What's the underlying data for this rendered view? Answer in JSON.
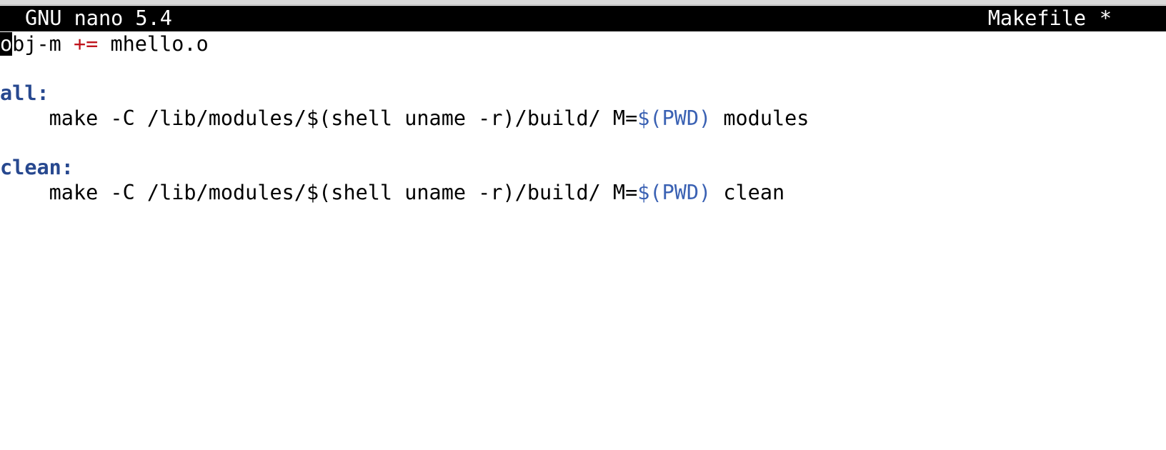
{
  "titlebar": {
    "app_version": "GNU nano 5.4",
    "file_name": "Makefile",
    "modified_flag": "*"
  },
  "editor": {
    "lines": [
      {
        "cursor_char": "o",
        "text": "bj-m ",
        "operator": "+=",
        "rest": " mhello.o"
      },
      {
        "text": ""
      },
      {
        "target": "all:"
      },
      {
        "indent": "    ",
        "text": "make -C /lib/modules/$(shell uname -r)/build/ M=",
        "variable": "$(PWD)",
        "rest": " modules"
      },
      {
        "text": ""
      },
      {
        "target": "clean:"
      },
      {
        "indent": "    ",
        "text": "make -C /lib/modules/$(shell uname -r)/build/ M=",
        "variable": "$(PWD)",
        "rest": " clean"
      }
    ]
  },
  "colors": {
    "titlebar_bg": "#000000",
    "titlebar_fg": "#ffffff",
    "operator": "#c0141c",
    "target": "#27488f",
    "variable": "#3a61b3"
  }
}
